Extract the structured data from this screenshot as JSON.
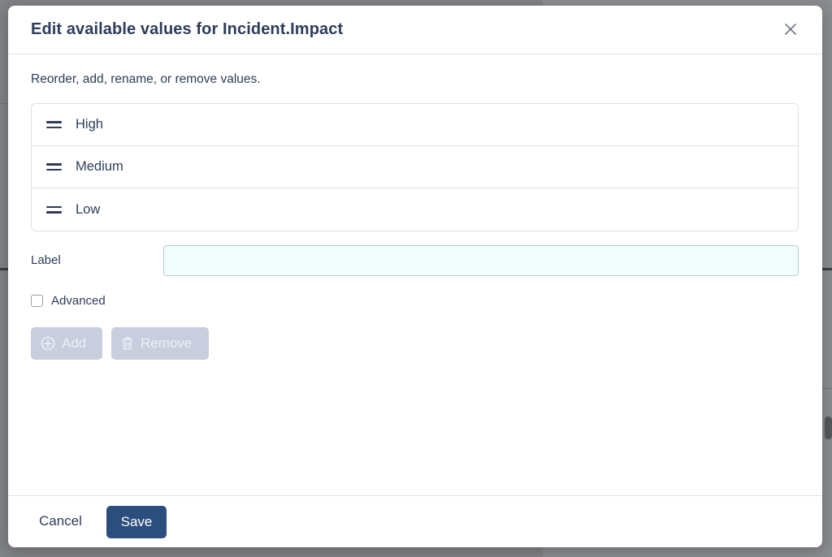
{
  "dialog": {
    "title": "Edit available values for Incident.Impact",
    "close_icon": "close-icon",
    "description": "Reorder, add, rename, or remove values.",
    "values": [
      {
        "label": "High"
      },
      {
        "label": "Medium"
      },
      {
        "label": "Low"
      }
    ],
    "label_field": {
      "label": "Label",
      "value": "",
      "placeholder": ""
    },
    "advanced": {
      "label": "Advanced",
      "checked": false
    },
    "add_button": {
      "label": "Add",
      "icon": "plus-circle-icon",
      "disabled": true
    },
    "remove_button": {
      "label": "Remove",
      "icon": "trash-icon",
      "disabled": true
    },
    "footer": {
      "cancel_label": "Cancel",
      "save_label": "Save"
    }
  },
  "colors": {
    "primary": "#2c4e7e",
    "text": "#2e3d5a",
    "disabled_bg": "#c9cede",
    "input_bg": "#f2fcfc",
    "input_border": "#a9d6d3",
    "border": "#dde1e6"
  }
}
